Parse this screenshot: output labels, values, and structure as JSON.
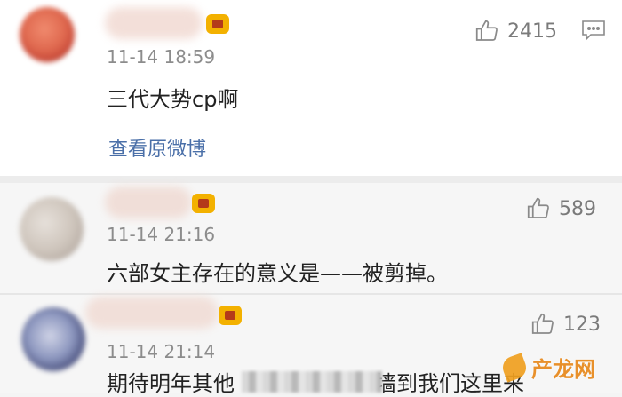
{
  "comments": [
    {
      "timestamp": "11-14 18:59",
      "text": "三代大势cp啊",
      "likes": "2415",
      "view_original": "查看原微博"
    },
    {
      "timestamp": "11-14 21:16",
      "text": "六部女主存在的意义是——被剪掉。",
      "likes": "589"
    },
    {
      "timestamp": "11-14 21:14",
      "text_visible_prefix": "期待明年其他",
      "text_visible_suffix": "墙到我们这里来",
      "likes": "123"
    }
  ],
  "watermark": {
    "text": "产龙网"
  },
  "icons": {
    "like": "thumbs-up-icon",
    "reply": "comment-icon",
    "vip": "vip-crown-icon"
  },
  "colors": {
    "link": "#4a6fa8",
    "timestamp": "#8c8c8c",
    "like": "#7a7a7a",
    "vip": "#f3b100",
    "watermark": "#e7881a"
  }
}
